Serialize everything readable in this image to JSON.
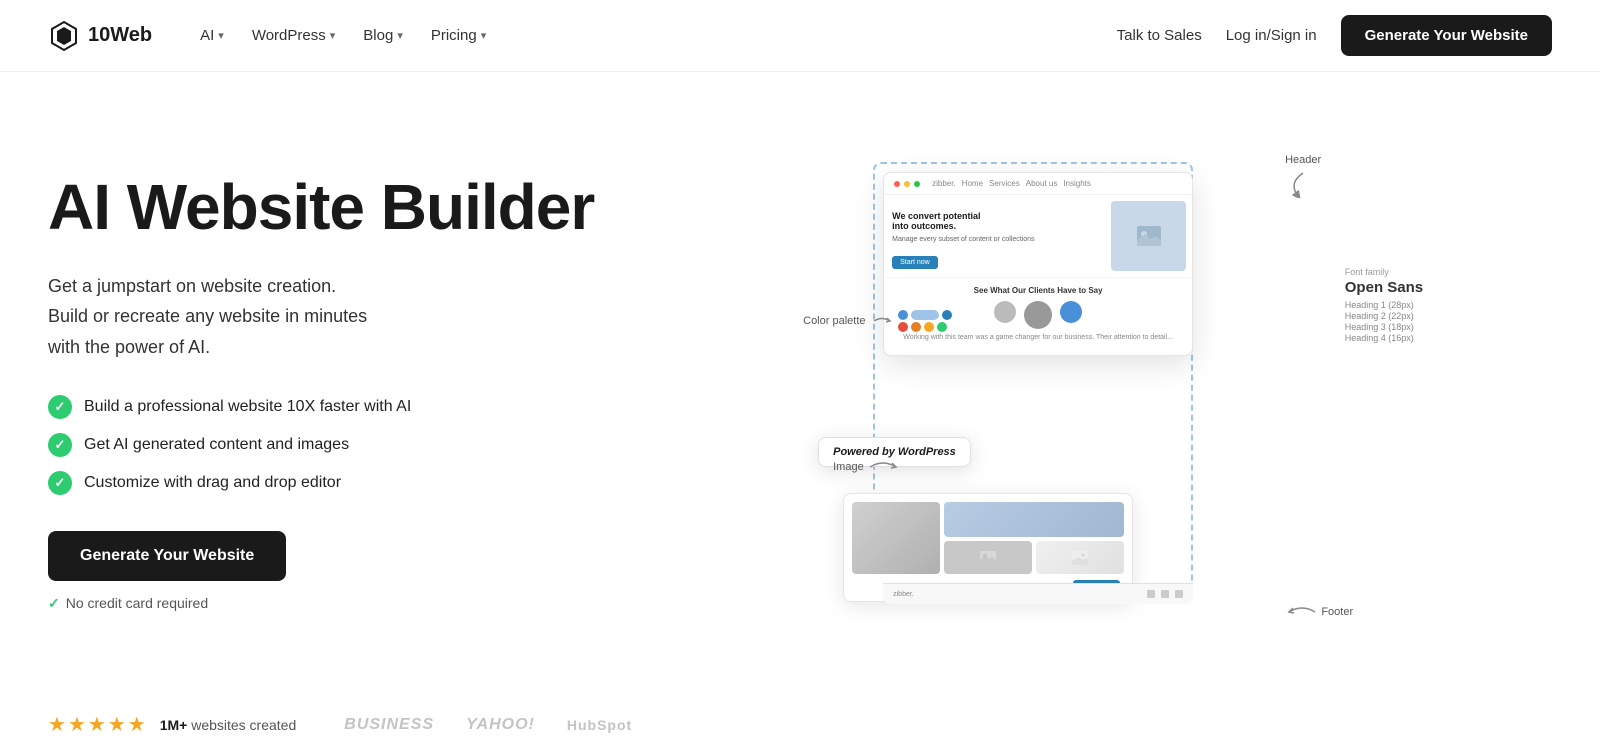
{
  "logo": {
    "name": "10Web",
    "full": "10Web"
  },
  "nav": {
    "links": [
      {
        "label": "AI",
        "has_dropdown": true
      },
      {
        "label": "WordPress",
        "has_dropdown": true
      },
      {
        "label": "Blog",
        "has_dropdown": true
      },
      {
        "label": "Pricing",
        "has_dropdown": true
      }
    ],
    "talk_to_sales": "Talk to Sales",
    "login": "Log in/Sign in",
    "cta": "Generate Your Website"
  },
  "hero": {
    "title": "AI Website Builder",
    "subtitle_line1": "Get a jumpstart on website creation.",
    "subtitle_line2": "Build or recreate any website in minutes",
    "subtitle_line3": "with the power of AI.",
    "features": [
      "Build a professional website 10X faster with AI",
      "Get AI generated content and images",
      "Customize with drag and drop editor"
    ],
    "cta": "Generate Your Website",
    "no_cc": "No credit card required"
  },
  "illustration": {
    "color_palette_label": "Color palette",
    "image_label": "Image",
    "header_label": "Header",
    "footer_label": "Footer",
    "font_family_label": "Font family",
    "font_name": "Open Sans",
    "heading1": "Heading 1 (28px)",
    "heading2": "Heading 2 (22px)",
    "heading3": "Heading 3 (18px)",
    "heading4": "Heading 4 (16px)",
    "preview": {
      "site_name": "zibber.",
      "nav_items": [
        "Home",
        "Services",
        "About us",
        "Insights"
      ],
      "hero_title": "We convert potential into outcomes.",
      "hero_text": "Manage every subset of content or collections",
      "hero_btn": "Start now",
      "section_title": "See What Our Clients Have to Say",
      "wp_badge": "Powered by WordPress"
    },
    "palette_colors": {
      "row1": [
        "#4a90d9",
        "#a0c4e8",
        "#2980b9"
      ],
      "row2": [
        "#e74c3c",
        "#e67e22",
        "#f5a623",
        "#2ecc71"
      ]
    }
  },
  "bottom": {
    "stars": 5,
    "count_label": "1M+",
    "count_suffix": "websites created",
    "brands": [
      "BUSINESS",
      "YAHOO!",
      "HubSpot"
    ]
  }
}
